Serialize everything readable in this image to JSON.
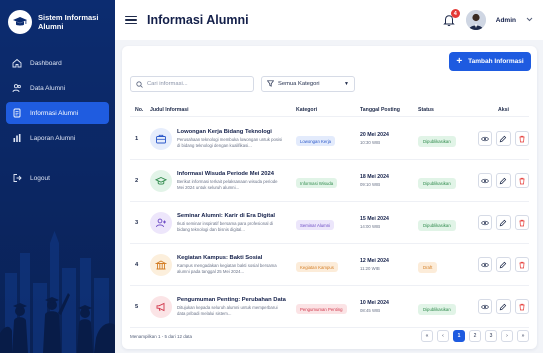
{
  "brand": {
    "line1": "Sistem Informasi",
    "line2": "Alumni"
  },
  "sidebar": {
    "items": [
      {
        "label": "Dashboard",
        "icon": "home-icon"
      },
      {
        "label": "Data Alumni",
        "icon": "users-icon"
      },
      {
        "label": "Informasi Alumni",
        "icon": "document-icon",
        "active": true
      },
      {
        "label": "Laporan Alumni",
        "icon": "bar-chart-icon"
      }
    ],
    "logout": {
      "label": "Logout",
      "icon": "logout-icon"
    }
  },
  "header": {
    "title": "Informasi Alumni",
    "notification_count": "4",
    "user_name": "Admin"
  },
  "toolbar": {
    "add_label": "Tambah Informasi",
    "search_placeholder": "Cari informasi...",
    "filter_label": "Semua Kategori"
  },
  "table": {
    "headers": {
      "no": "No.",
      "title": "Judul Informasi",
      "category": "Kategori",
      "date": "Tanggal Posting",
      "status": "Status",
      "actions": "Aksi"
    },
    "rows": [
      {
        "no": "1",
        "title": "Lowongan Kerja Bidang Teknologi",
        "desc": "Perusahaan teknologi membuka lowongan untuk posisi di bidang teknologi dengan kualifikasi...",
        "category": "Lowongan Kerja",
        "date": "20 Mei 2024",
        "time": "10:30 WIB",
        "status": "Dipublikasikan"
      },
      {
        "no": "2",
        "title": "Informasi Wisuda Periode Mei 2024",
        "desc": "Berikut informasi terkait pelaksanaan wisuda periode Mei 2024 untuk seluruh alumni...",
        "category": "Informasi Wisuda",
        "date": "18 Mei 2024",
        "time": "09:10 WIB",
        "status": "Dipublikasikan"
      },
      {
        "no": "3",
        "title": "Seminar Alumni: Karir di Era Digital",
        "desc": "Ikuti seminar inspiratif bersama para profesional di bidang teknologi dan bisnis digital...",
        "category": "Seminar Alumni",
        "date": "15 Mei 2024",
        "time": "14:00 WIB",
        "status": "Dipublikasikan"
      },
      {
        "no": "4",
        "title": "Kegiatan Kampus: Bakti Sosial",
        "desc": "Kampus mengadakan kegiatan bakti sosial bersama alumni pada tanggal 25 Mei 2024...",
        "category": "Kegiatan Kampus",
        "date": "12 Mei 2024",
        "time": "11:20 WIB",
        "status": "Draft"
      },
      {
        "no": "5",
        "title": "Pengumuman Penting: Perubahan Data",
        "desc": "Ditujukan kepada seluruh alumni untuk memperbarui data pribadi melalui sistem...",
        "category": "Pengumuman Penting",
        "date": "10 Mei 2024",
        "time": "08:45 WIB",
        "status": "Dipublikasikan"
      }
    ]
  },
  "footer": {
    "summary": "Menampilkan 1 - 5 dari 12 data"
  },
  "pagination": {
    "first": "«",
    "prev": "‹",
    "pages": [
      "1",
      "2",
      "3"
    ],
    "next": "›",
    "last": "»",
    "current": "1"
  },
  "colors": {
    "primary": "#1e5be0",
    "sidebar": "#0c2c70",
    "danger": "#e53935"
  }
}
